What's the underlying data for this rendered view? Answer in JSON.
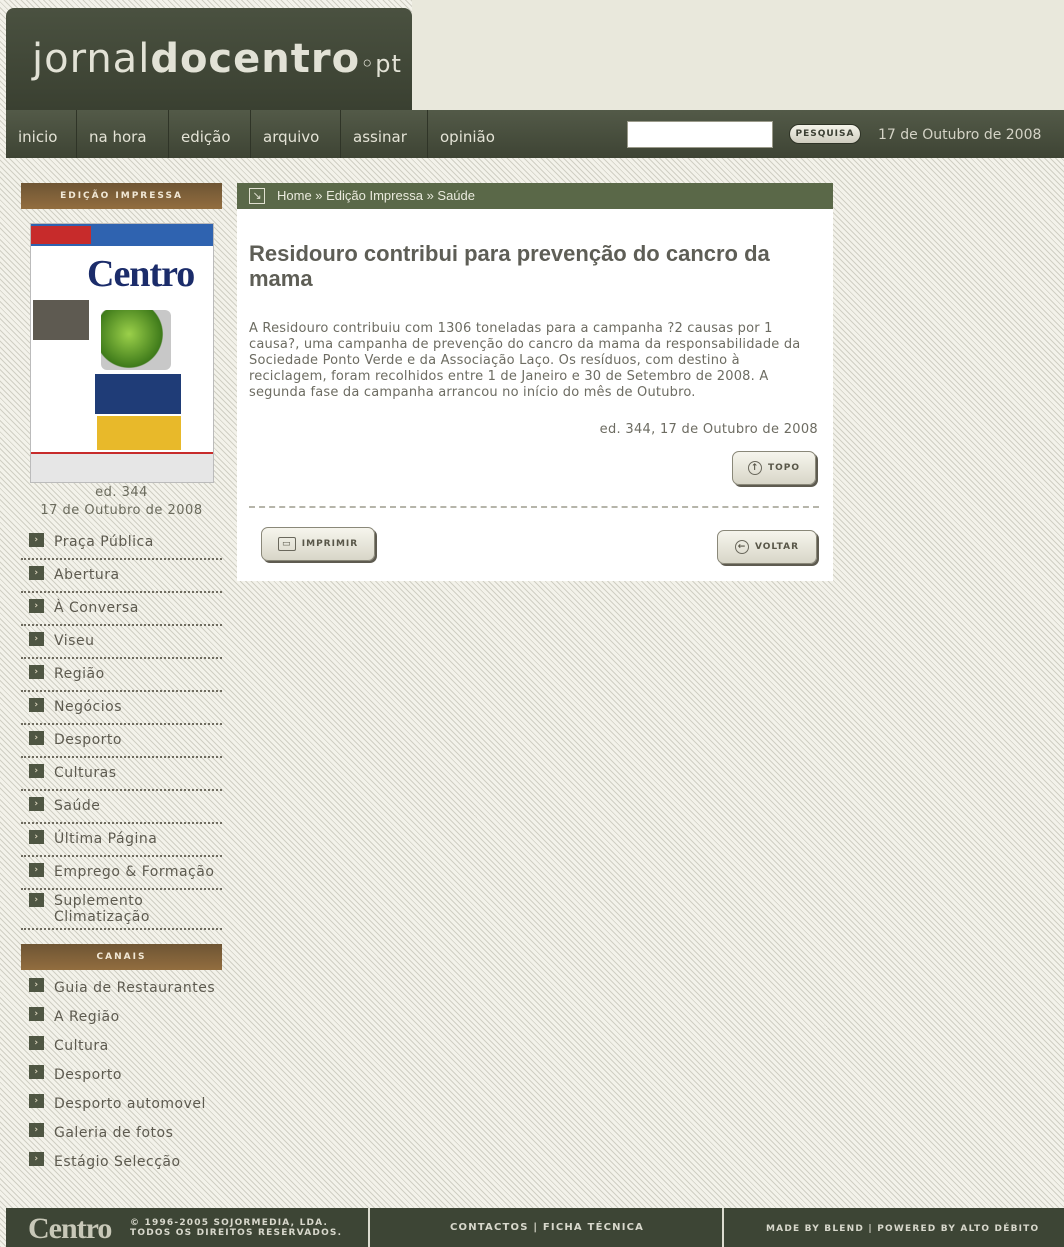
{
  "header": {
    "logo_main": "jornal",
    "logo_bold": "docentro",
    "logo_suffix": "pt",
    "search_button": "PESQUISA",
    "date": "17 de Outubro de 2008"
  },
  "nav": {
    "items": [
      "inicio",
      "na hora",
      "edição",
      "arquivo",
      "assinar",
      "opinião"
    ]
  },
  "sidebar": {
    "header": "EDIÇÃO IMPRESSA",
    "cover_title": "Centro",
    "edition_number": "ed. 344",
    "edition_date": "17 de Outubro de 2008",
    "sections": [
      "Praça Pública",
      "Abertura",
      "À Conversa",
      "Viseu",
      "Região",
      "Negócios",
      "Desporto",
      "Culturas",
      "Saúde",
      "Última Página",
      "Emprego & Formação",
      "Suplemento Climatização"
    ],
    "canais_header": "CANAIS",
    "canais": [
      "Guia de Restaurantes",
      "A Região",
      "Cultura",
      "Desporto",
      "Desporto automovel",
      "Galeria de fotos",
      "Estágio Selecção"
    ]
  },
  "breadcrumb": "Home » Edição Impressa » Saúde",
  "article": {
    "title": "Residouro contribui para prevenção do cancro da mama",
    "body": "A Residouro contribuiu com 1306 toneladas para a campanha ?2 causas por 1 causa?, uma campanha de prevenção do cancro da mama da responsabilidade da Sociedade Ponto Verde e da Associação Laço. Os resíduos, com destino à reciclagem, foram recolhidos entre 1 de Janeiro e 30 de Setembro de 2008. A segunda fase da campanha arrancou no início do mês de Outubro.",
    "edition": "ed. 344, 17 de Outubro de 2008",
    "top_button": "TOPO",
    "print_button": "IMPRIMIR",
    "back_button": "VOLTAR"
  },
  "footer": {
    "logo": "Centro",
    "copyright_line1": "© 1996-2005 SOJORMEDIA, LDA.",
    "copyright_line2": "TODOS OS DIREITOS RESERVADOS.",
    "links": "CONTACTOS | FICHA TÉCNICA",
    "credits": "MADE BY BLEND | POWERED BY ALTO DÉBITO"
  },
  "colors": {
    "nav_bg": "#4a5140",
    "sidebar_header": "#7e5f38",
    "breadcrumb_bg": "#5a6848"
  }
}
